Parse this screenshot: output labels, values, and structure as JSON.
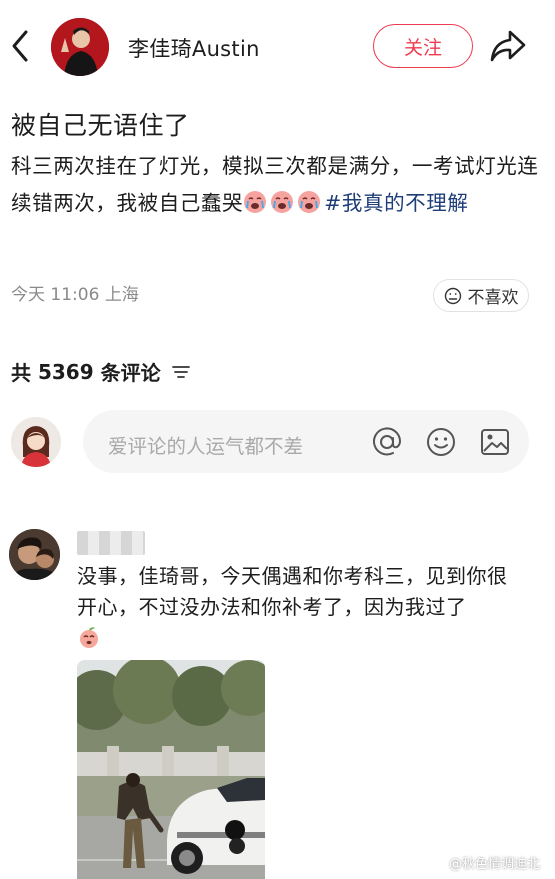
{
  "header": {
    "back_icon": "chevron-left-icon",
    "author_name": "李佳琦Austin",
    "follow_label": "关注",
    "share_icon": "share-arrow-icon"
  },
  "post": {
    "title": "被自己无语住了",
    "body_text": "科三两次挂在了灯光，模拟三次都是满分，一考试灯光连续错两次，我被自己蠢哭",
    "emoji": "crying-face-emoji",
    "hashtag": "#我真的不理解",
    "time": "今天 11:06",
    "location": "上海",
    "dislike_label": "不喜欢"
  },
  "comments_section": {
    "count_prefix": "共",
    "count": "5369",
    "count_suffix": "条评论",
    "input_placeholder": "爱评论的人运气都不差",
    "input_icons": [
      "at-icon",
      "emoji-icon",
      "image-icon"
    ]
  },
  "comments": [
    {
      "text": "没事，佳琦哥，今天偶遇和你考科三，见到你很开心，不过没办法和你补考了，因为我过了",
      "emoji": "peach-face-emoji"
    }
  ],
  "watermark": "@秋色情调迪北",
  "colors": {
    "accent": "#ee3b50",
    "hashtag": "#1e3e78",
    "meta_gray": "#8a8a8a",
    "input_bg": "#f5f5f5"
  }
}
